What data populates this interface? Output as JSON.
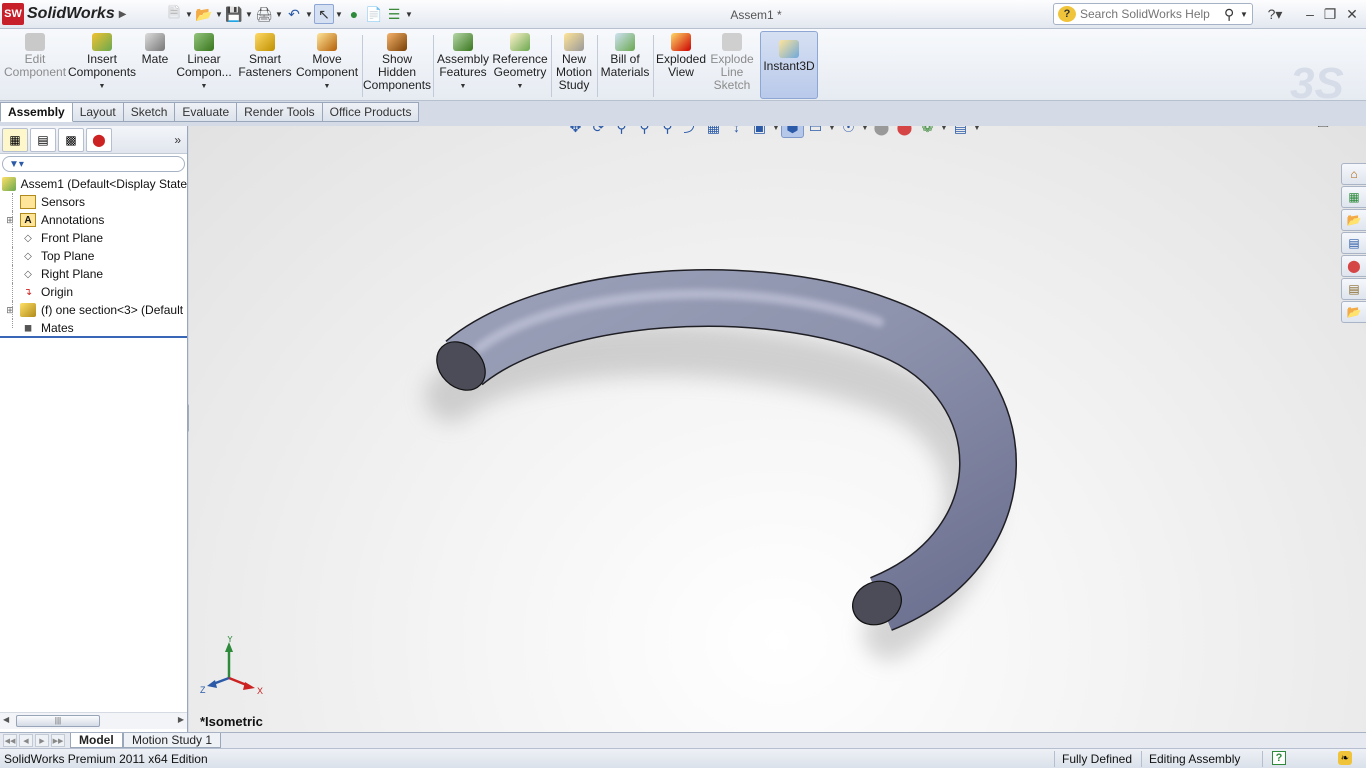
{
  "app": {
    "brand": "SolidWorks",
    "brand_badge": "SW",
    "document_title": "Assem1 *"
  },
  "quick_access": {
    "items": [
      "new-document-icon",
      "open-icon",
      "save-icon",
      "print-icon",
      "undo-icon",
      "select-icon",
      "rebuild-icon",
      "file-properties-icon",
      "options-icon"
    ]
  },
  "search": {
    "placeholder": "Search SolidWorks Help"
  },
  "ribbon": {
    "edit_component": "Edit\nComponent",
    "insert_components": "Insert\nComponents",
    "mate": "Mate",
    "linear_component": "Linear\nCompon...",
    "smart_fasteners": "Smart\nFasteners",
    "move_component": "Move\nComponent",
    "show_hidden": "Show\nHidden\nComponents",
    "assembly_features": "Assembly\nFeatures",
    "reference_geometry": "Reference\nGeometry",
    "new_motion_study": "New\nMotion\nStudy",
    "bill_of_materials": "Bill of\nMaterials",
    "exploded_view": "Exploded\nView",
    "explode_line_sketch": "Explode\nLine\nSketch",
    "instant3d": "Instant3D"
  },
  "cm_tabs": [
    "Assembly",
    "Layout",
    "Sketch",
    "Evaluate",
    "Render Tools",
    "Office Products"
  ],
  "feature_tree": {
    "root": "Assem1  (Default<Display State",
    "items": [
      {
        "label": "Sensors",
        "icon": "sensors-icon"
      },
      {
        "label": "Annotations",
        "icon": "annotations-icon"
      },
      {
        "label": "Front Plane",
        "icon": "plane-icon"
      },
      {
        "label": "Top Plane",
        "icon": "plane-icon"
      },
      {
        "label": "Right Plane",
        "icon": "plane-icon"
      },
      {
        "label": "Origin",
        "icon": "origin-icon"
      },
      {
        "label": "(f) one section<3> (Default",
        "icon": "part-icon"
      },
      {
        "label": "Mates",
        "icon": "mates-icon"
      }
    ]
  },
  "viewport": {
    "view_name": "*Isometric",
    "triad": {
      "x": "X",
      "y": "Y",
      "z": "Z"
    }
  },
  "bottom_tabs": [
    "Model",
    "Motion Study 1"
  ],
  "status": {
    "edition": "SolidWorks Premium 2011 x64 Edition",
    "defined": "Fully Defined",
    "mode": "Editing Assembly"
  },
  "colors": {
    "brand_red": "#c8202b",
    "accent_blue": "#3a66b8",
    "part_steel": "#8a8fa8"
  }
}
